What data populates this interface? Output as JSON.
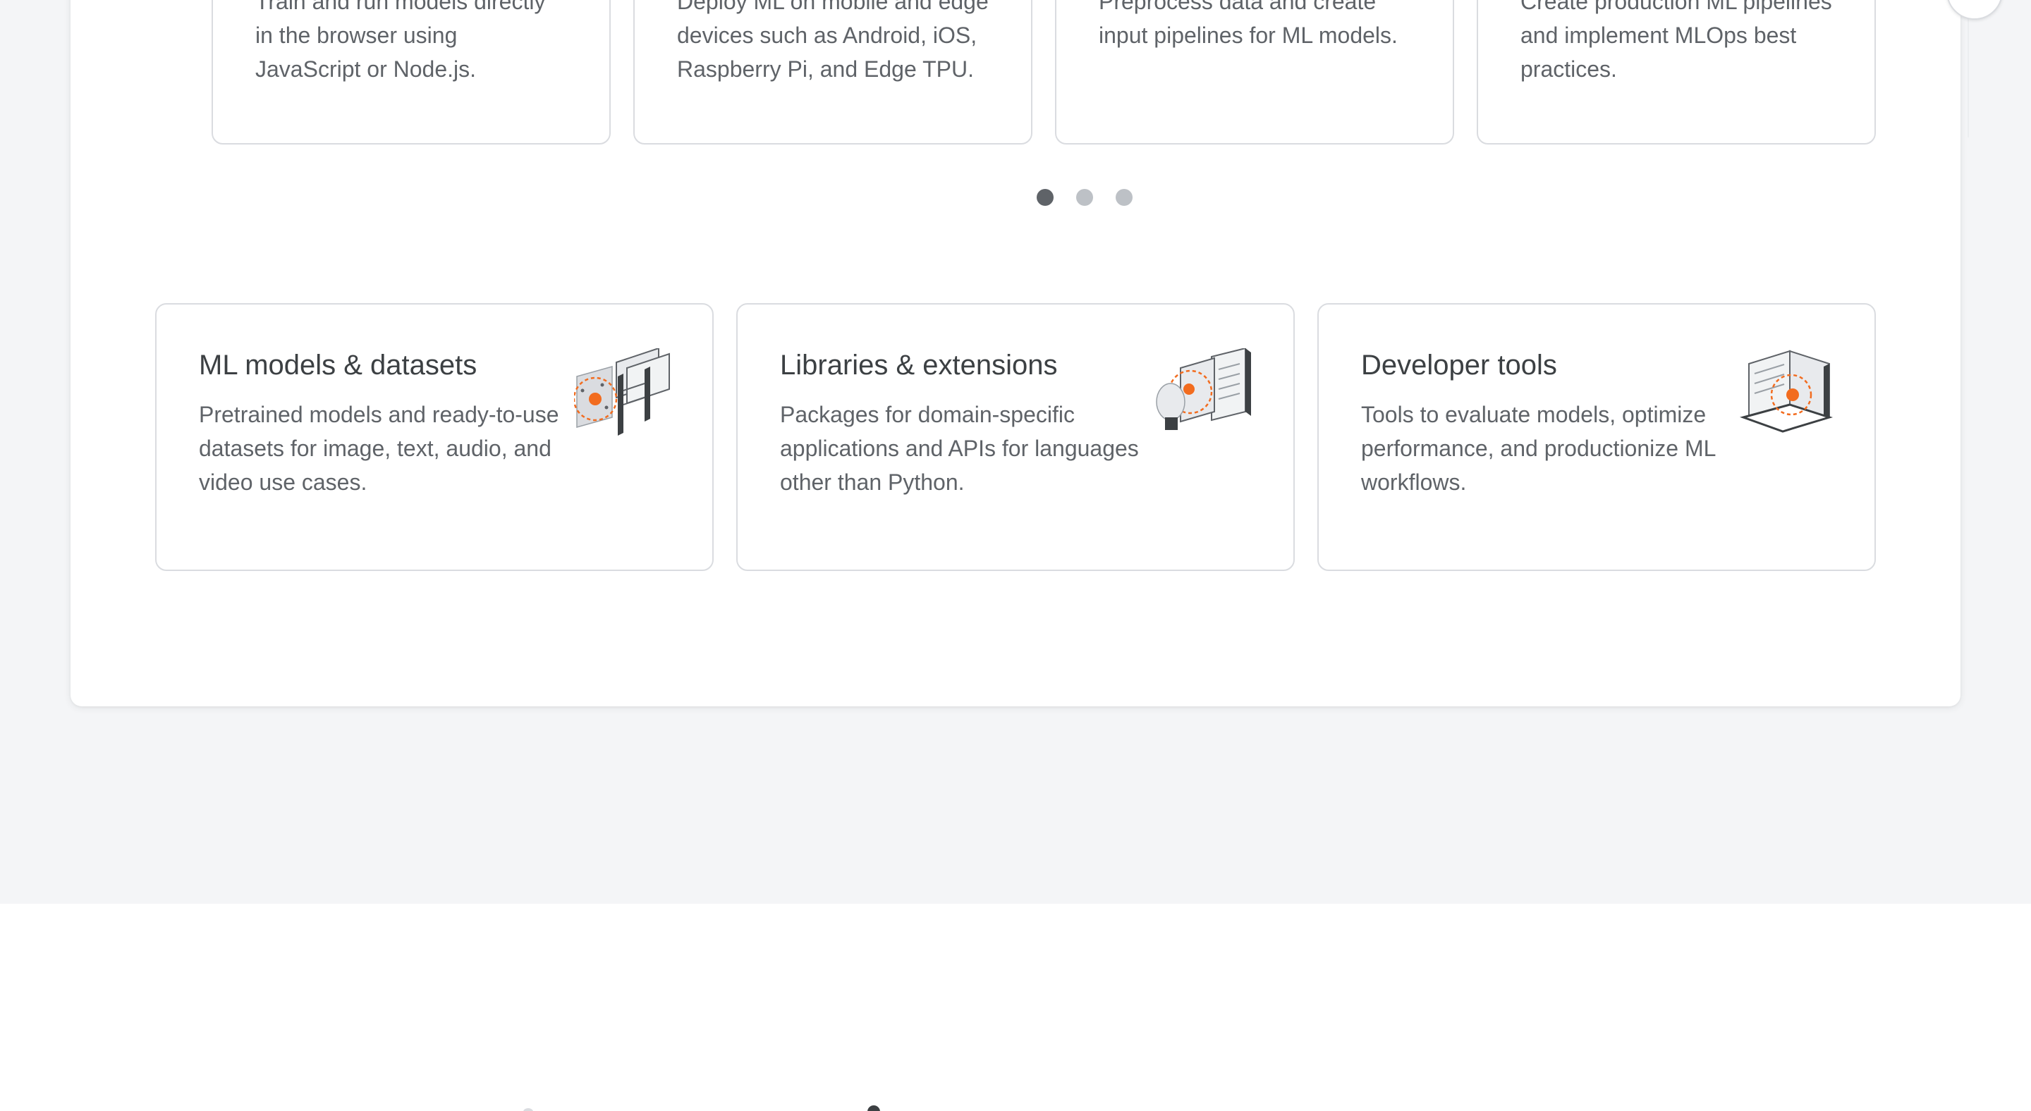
{
  "carousel": {
    "cards": [
      {
        "description": "Train and run models directly in the browser using JavaScript or Node.js."
      },
      {
        "description": "Deploy ML on mobile and edge devices such as Android, iOS, Raspberry Pi, and Edge TPU."
      },
      {
        "description": "Preprocess data and create input pipelines for ML models."
      },
      {
        "description": "Create production ML pipelines and implement MLOps best practices."
      }
    ],
    "next_icon": "chevron-right-icon",
    "pagination": {
      "count": 3,
      "active": 1
    }
  },
  "features": [
    {
      "title": "ML models & datasets",
      "description": "Pretrained models and ready-to-use datasets for image, text, audio, and video use cases.",
      "icon": "models-datasets-illustration-icon"
    },
    {
      "title": "Libraries & extensions",
      "description": "Packages for domain-specific applications and APIs for languages other than Python.",
      "icon": "libraries-extensions-illustration-icon"
    },
    {
      "title": "Developer tools",
      "description": "Tools to evaluate models, optimize performance, and productionize ML workflows.",
      "icon": "developer-tools-illustration-icon"
    }
  ],
  "colors": {
    "accent": "#f26c1f",
    "text_primary": "#3c4043",
    "text_secondary": "#5f6368",
    "border": "#dadce0",
    "page_background": "#f4f5f7"
  }
}
